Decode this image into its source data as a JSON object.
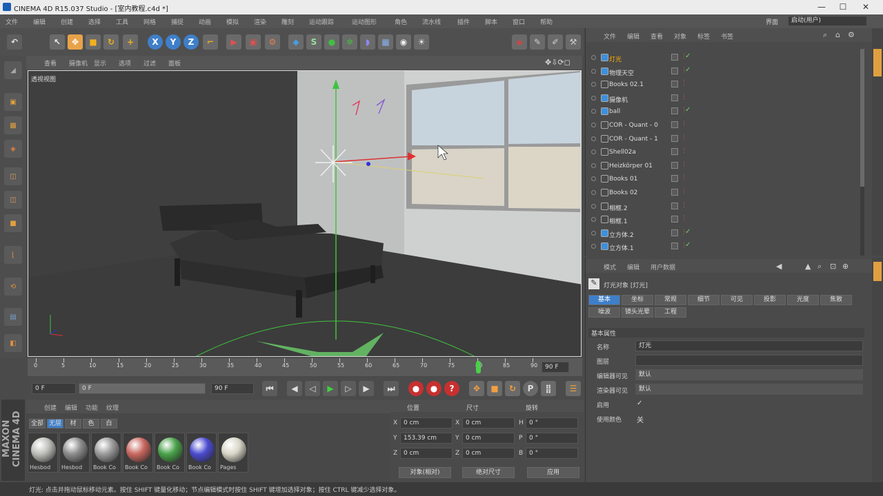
{
  "window": {
    "title": "CINEMA 4D R15.037 Studio - [室内教程.c4d *]",
    "min": "—",
    "max": "☐",
    "close": "✕"
  },
  "menubar": [
    "文件",
    "编辑",
    "创建",
    "选择",
    "工具",
    "网格",
    "捕捉",
    "动画",
    "模拟",
    "渲染",
    "雕刻",
    "运动跟踪",
    "运动图形",
    "角色",
    "流水线",
    "插件",
    "脚本",
    "窗口",
    "帮助"
  ],
  "layout": {
    "label": "界面",
    "value": "启动(用户)"
  },
  "viewport": {
    "label": "透视视图",
    "menus": [
      "查看",
      "摄像机",
      "显示",
      "选项",
      "过滤",
      "面板"
    ]
  },
  "timeline": {
    "ticks": [
      "0",
      "5",
      "10",
      "15",
      "20",
      "25",
      "30",
      "35",
      "40",
      "45",
      "50",
      "55",
      "60",
      "65",
      "70",
      "75",
      "80",
      "85",
      "90"
    ],
    "end": "90 F",
    "current": 80
  },
  "playbar": {
    "start": "0 F",
    "current": "0 F",
    "end": "90 F"
  },
  "material": {
    "menus": [
      "创建",
      "编辑",
      "功能",
      "纹理"
    ],
    "tabs": [
      "全部",
      "无层",
      "材",
      "色",
      "白"
    ],
    "items": [
      "Hesbod",
      "Hesbod",
      "Book Co",
      "Book Co",
      "Book Co",
      "Book Co",
      "Pages"
    ],
    "colors": [
      "#bdbdb8",
      "#8c8c8c",
      "#9a9a9a",
      "#c9675f",
      "#4aa24a",
      "#4b4bd0",
      "#d8d6c8"
    ]
  },
  "coords": {
    "headers": [
      "位置",
      "尺寸",
      "旋转"
    ],
    "rows": [
      {
        "axis": "X",
        "pos": "0 cm",
        "saxis": "X",
        "size": "0 cm",
        "raxis": "H",
        "rot": "0 °"
      },
      {
        "axis": "Y",
        "pos": "153.39 cm",
        "saxis": "Y",
        "size": "0 cm",
        "raxis": "P",
        "rot": "0 °"
      },
      {
        "axis": "Z",
        "pos": "0 cm",
        "saxis": "Z",
        "size": "0 cm",
        "raxis": "B",
        "rot": "0 °"
      }
    ],
    "mode": "对象(相对)",
    "sizemode": "绝对尺寸",
    "apply": "应用"
  },
  "objmgr": {
    "menus": [
      "文件",
      "编辑",
      "查看",
      "对象",
      "标签",
      "书签"
    ],
    "objects": [
      {
        "name": "灯光",
        "icon": "light-icon",
        "color": "#ffb000",
        "tick": true
      },
      {
        "name": "物理天空",
        "icon": "sky-icon",
        "color": "#ddd",
        "tick": true
      },
      {
        "name": "Books 02.1",
        "icon": "null-icon",
        "color": "#ddd",
        "tick": false
      },
      {
        "name": "摄像机",
        "icon": "camera-icon",
        "color": "#ddd",
        "tick": false
      },
      {
        "name": "ball",
        "icon": "sphere-icon",
        "color": "#ddd",
        "tick": true
      },
      {
        "name": "COR - Quant - 0",
        "icon": "null-icon",
        "color": "#ddd",
        "tick": false
      },
      {
        "name": "COR - Quant - 1",
        "icon": "null-icon",
        "color": "#ddd",
        "tick": false
      },
      {
        "name": "Shell02a",
        "icon": "null-icon",
        "color": "#ddd",
        "tick": false
      },
      {
        "name": "Heizkörper 01",
        "icon": "null-icon",
        "color": "#ddd",
        "tick": false
      },
      {
        "name": "Books 01",
        "icon": "null-icon",
        "color": "#ddd",
        "tick": false
      },
      {
        "name": "Books 02",
        "icon": "null-icon",
        "color": "#ddd",
        "tick": false
      },
      {
        "name": "相框.2",
        "icon": "null-icon",
        "color": "#ddd",
        "tick": false
      },
      {
        "name": "相框.1",
        "icon": "null-icon",
        "color": "#ddd",
        "tick": false
      },
      {
        "name": "立方体.2",
        "icon": "cube-icon",
        "color": "#ddd",
        "tick": true
      },
      {
        "name": "立方体.1",
        "icon": "cube-icon",
        "color": "#ddd",
        "tick": true
      }
    ]
  },
  "attrmgr": {
    "menus": [
      "模式",
      "编辑",
      "用户数据"
    ],
    "objtitle": "灯光对象 [灯光]",
    "tabs1": [
      "基本",
      "坐标",
      "常规",
      "细节",
      "可见",
      "投影",
      "光度",
      "焦散"
    ],
    "tabs2": [
      "噪波",
      "镜头光晕",
      "工程"
    ],
    "section": "基本属性",
    "fields": [
      {
        "label": "名称",
        "value": "灯光"
      },
      {
        "label": "图层",
        "value": ""
      },
      {
        "label": "编辑器可见",
        "value": "默认"
      },
      {
        "label": "渲染器可见",
        "value": "默认"
      },
      {
        "label": "启用",
        "value": "✓"
      },
      {
        "label": "使用颜色",
        "value": "关"
      }
    ]
  },
  "status": "灯光: 点击并拖动鼠标移动元素。按住 SHIFT 键量化移动；节点编辑模式时按住 SHIFT 键增加选择对象；按住 CTRL 键减少选择对象。",
  "brand": "MAXON CINEMA 4D"
}
